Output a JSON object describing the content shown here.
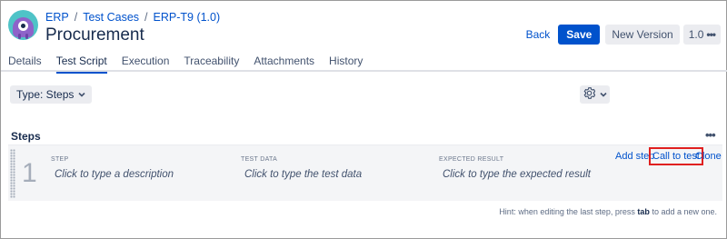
{
  "breadcrumb": {
    "items": [
      "ERP",
      "Test Cases",
      "ERP-T9 (1.0)"
    ],
    "separator": "/"
  },
  "page": {
    "title": "Procurement"
  },
  "actions": {
    "back": "Back",
    "save": "Save",
    "new_version": "New Version",
    "version": "1.0",
    "more": "•••"
  },
  "tabs": [
    {
      "label": "Details",
      "active": false
    },
    {
      "label": "Test Script",
      "active": true
    },
    {
      "label": "Execution",
      "active": false
    },
    {
      "label": "Traceability",
      "active": false
    },
    {
      "label": "Attachments",
      "active": false
    },
    {
      "label": "History",
      "active": false
    }
  ],
  "toolbar": {
    "type_select": "Type: Steps",
    "settings_icon": "gear-icon"
  },
  "steps": {
    "header": "Steps",
    "more": "•••",
    "columns": {
      "step": "STEP",
      "test_data": "TEST DATA",
      "expected_result": "EXPECTED RESULT"
    },
    "rows": [
      {
        "number": "1",
        "description": "Click to type a description",
        "test_data": "Click to type the test data",
        "expected_result": "Click to type the expected result"
      }
    ],
    "row_actions": {
      "add_step": "Add step",
      "call_to_test": "Call to test",
      "clone": "Clone"
    }
  },
  "hint": {
    "prefix": "Hint: when editing the last step, press",
    "key": "tab",
    "suffix": "to add a new one."
  },
  "colors": {
    "primary": "#0052cc",
    "highlight_border": "#e02020",
    "row_background": "#f4f5f7"
  }
}
